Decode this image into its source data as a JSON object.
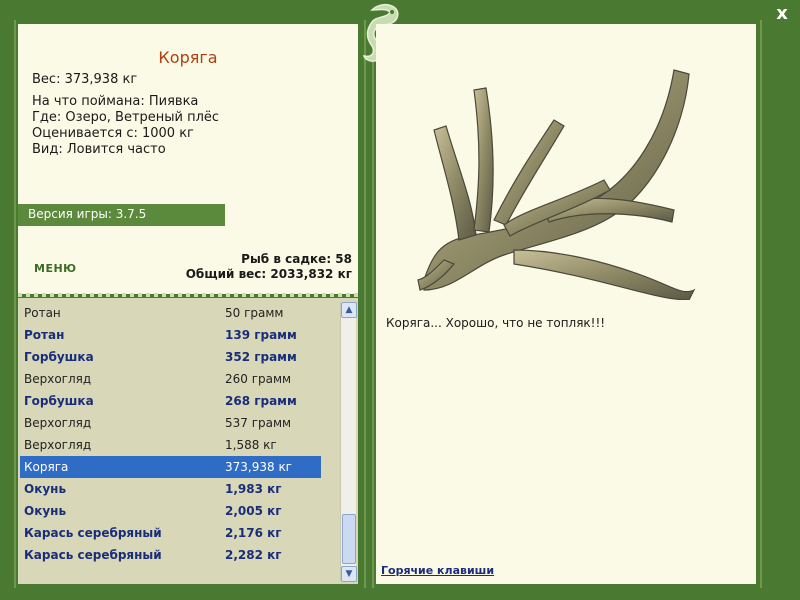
{
  "fish": {
    "title": "Коряга",
    "weight_line": "Вес: 373,938 кг",
    "bait_line": "На что поймана: Пиявка",
    "place_line": "Где: Озеро, Ветреный плёс",
    "value_line": "Оценивается с: 1000 кг",
    "kind_line": "Вид: Ловится часто",
    "description": "Коряга... Хорошо, что не топляк!!!"
  },
  "version": "Версия игры: 3.7.5",
  "menu_label": "МЕНЮ",
  "stats": {
    "count_line": "Рыб в садке: 58",
    "total_line": "Общий вес: 2033,832 кг"
  },
  "catch_list": [
    {
      "name": "Ротан",
      "weight": "50 грамм",
      "bold": false,
      "selected": false
    },
    {
      "name": "Ротан",
      "weight": "139 грамм",
      "bold": true,
      "selected": false
    },
    {
      "name": "Горбушка",
      "weight": "352 грамм",
      "bold": true,
      "selected": false
    },
    {
      "name": "Верхогляд",
      "weight": "260 грамм",
      "bold": false,
      "selected": false
    },
    {
      "name": "Горбушка",
      "weight": "268 грамм",
      "bold": true,
      "selected": false
    },
    {
      "name": "Верхогляд",
      "weight": "537 грамм",
      "bold": false,
      "selected": false
    },
    {
      "name": "Верхогляд",
      "weight": "1,588 кг",
      "bold": false,
      "selected": false
    },
    {
      "name": "Коряга",
      "weight": "373,938 кг",
      "bold": false,
      "selected": true
    },
    {
      "name": "Окунь",
      "weight": "1,983 кг",
      "bold": true,
      "selected": false
    },
    {
      "name": "Окунь",
      "weight": "2,005 кг",
      "bold": true,
      "selected": false
    },
    {
      "name": "Карась серебряный",
      "weight": "2,176 кг",
      "bold": true,
      "selected": false
    },
    {
      "name": "Карась серебряный",
      "weight": "2,282 кг",
      "bold": true,
      "selected": false
    }
  ],
  "hotkeys_label": "Горячие клавиши",
  "close_label": "x",
  "icons": {
    "close": "close-icon",
    "scroll_up": "chevron-up-icon",
    "scroll_down": "chevron-down-icon",
    "logo": "lizard-logo-icon"
  },
  "colors": {
    "frame": "#4a7a32",
    "panel": "#fafae6",
    "list_bg": "#d8d8b8",
    "selected": "#2f6cc6",
    "title": "#b04010",
    "bold_item": "#1a2d7a"
  }
}
